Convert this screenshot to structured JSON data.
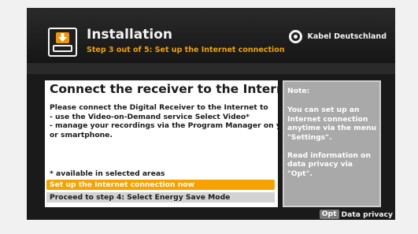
{
  "header": {
    "title": "Installation",
    "step": "Step 3 out of 5: Set up the Internet connection",
    "brand": "Kabel Deutschland",
    "icon": "download-to-receiver-icon",
    "brand_icon": "kabel-deutschland-logo-icon"
  },
  "main": {
    "title": "Connect the receiver to the Internet",
    "body_lines": [
      "Please connect the Digital Receiver to the Internet to",
      "- use the Video-on-Demand service Select Video*",
      "- manage your recordings via the Program Manager on your PC",
      "or smartphone."
    ],
    "footnote": "* available in selected areas",
    "options": [
      {
        "label": "Set up the Internet connection now",
        "selected": true
      },
      {
        "label": "Proceed to step 4: Select Energy Save Mode",
        "selected": false
      }
    ]
  },
  "note": {
    "heading": "Note:",
    "paragraphs": [
      "You can set up an Internet connection anytime via the menu \"Settings\".",
      "Read information on data privacy via \"Opt\"."
    ]
  },
  "footer": {
    "key": "Opt",
    "label": "Data privacy"
  },
  "colors": {
    "accent": "#f6a300",
    "panel": "#ffffff",
    "note_panel": "#a9a9a9",
    "background": "#1a1a1a"
  }
}
